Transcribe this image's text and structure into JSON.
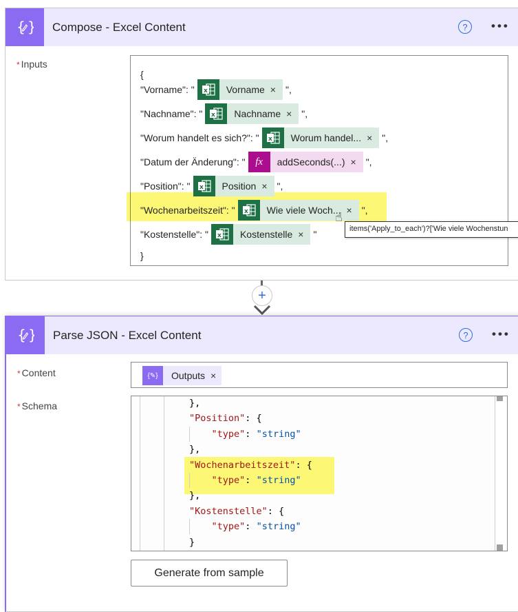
{
  "compose": {
    "title": "Compose - Excel Content",
    "inputs_label": "Inputs",
    "open_brace": "{",
    "close_brace": "}",
    "lines": [
      {
        "key": "\"Vorname\": \"",
        "token": "Vorname",
        "token_type": "excel",
        "suffix": "\","
      },
      {
        "key": "\"Nachname\": \"",
        "token": "Nachname",
        "token_type": "excel",
        "suffix": "\","
      },
      {
        "key": "\"Worum handelt es sich?\": \"",
        "token": "Worum handel...",
        "token_type": "excel",
        "suffix": "\","
      },
      {
        "key": "\"Datum der Änderung\": \"",
        "token": "addSeconds(...)",
        "token_type": "fx",
        "suffix": "\","
      },
      {
        "key": "\"Position\": \"",
        "token": "Position",
        "token_type": "excel",
        "suffix": "\","
      },
      {
        "key": "\"Wochenarbeitszeit\": \"",
        "token": "Wie viele Woch...",
        "token_type": "excel",
        "suffix": "\","
      },
      {
        "key": "\"Kostenstelle\": \"",
        "token": "Kostenstelle",
        "token_type": "excel",
        "suffix": "\""
      }
    ],
    "tooltip": "items('Apply_to_each')?['Wie viele Wochenstun",
    "token_remove": "×",
    "fx_label": "fx"
  },
  "parse_json": {
    "title": "Parse JSON - Excel Content",
    "content_label": "Content",
    "content_token": "Outputs",
    "schema_label": "Schema",
    "schema_lines": [
      {
        "parts": [
          [
            "p",
            "},"
          ]
        ]
      },
      {
        "parts": [
          [
            "k",
            "\"Position\""
          ],
          [
            "p",
            ": {"
          ]
        ]
      },
      {
        "parts": [
          [
            "p",
            "    "
          ],
          [
            "k",
            "\"type\""
          ],
          [
            "p",
            ": "
          ],
          [
            "s",
            "\"string\""
          ]
        ]
      },
      {
        "parts": [
          [
            "p",
            "},"
          ]
        ]
      },
      {
        "parts": [
          [
            "k",
            "\"Wochenarbeitszeit\""
          ],
          [
            "p",
            ": {"
          ]
        ]
      },
      {
        "parts": [
          [
            "p",
            "    "
          ],
          [
            "k",
            "\"type\""
          ],
          [
            "p",
            ": "
          ],
          [
            "s",
            "\"string\""
          ]
        ]
      },
      {
        "parts": [
          [
            "p",
            "},"
          ]
        ]
      },
      {
        "parts": [
          [
            "k",
            "\"Kostenstelle\""
          ],
          [
            "p",
            ": {"
          ]
        ]
      },
      {
        "parts": [
          [
            "p",
            "    "
          ],
          [
            "k",
            "\"type\""
          ],
          [
            "p",
            ": "
          ],
          [
            "s",
            "\"string\""
          ]
        ]
      },
      {
        "parts": [
          [
            "p",
            "}"
          ]
        ]
      }
    ],
    "generate_button": "Generate from sample"
  },
  "common": {
    "required_mark": "*",
    "help": "?",
    "more": "•••",
    "add_step": "+"
  },
  "colors": {
    "accent": "#8a6bf2",
    "header_bg": "#ece8fd",
    "excel": "#1e7145",
    "excel_token_bg": "#d9ebe1",
    "fx": "#ab0d8e",
    "fx_token_bg": "#f4daf0",
    "highlight": "#fcf75e"
  }
}
